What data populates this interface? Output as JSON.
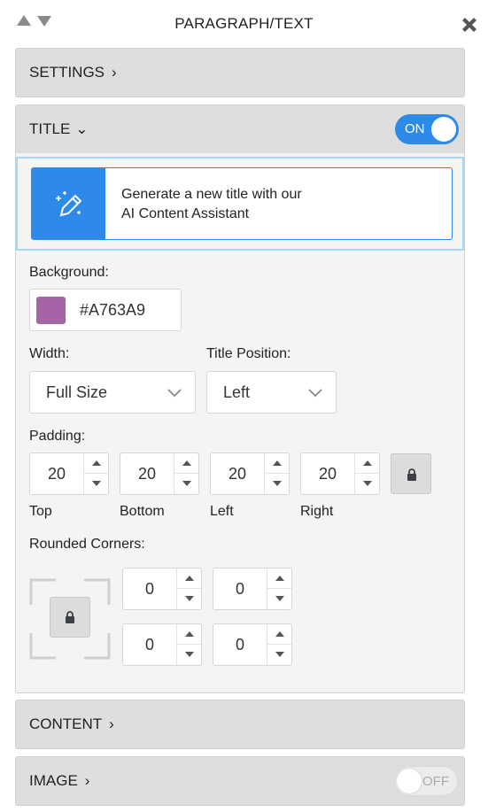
{
  "header": {
    "title": "PARAGRAPH/TEXT"
  },
  "sections": {
    "settings": {
      "label": "SETTINGS",
      "chevron": "›"
    },
    "title": {
      "label": "TITLE",
      "chevron": "⌄",
      "toggle": "ON"
    },
    "content": {
      "label": "CONTENT",
      "chevron": "›"
    },
    "image": {
      "label": "IMAGE",
      "chevron": "›",
      "toggle": "OFF"
    }
  },
  "ai_assistant": {
    "line1": "Generate a new title with our",
    "line2": "AI Content Assistant",
    "icon": "magic-pen-icon"
  },
  "background": {
    "label": "Background:",
    "hex": "#A763A9",
    "swatch_color": "#a763a9"
  },
  "width": {
    "label": "Width:",
    "value": "Full Size"
  },
  "title_position": {
    "label": "Title Position:",
    "value": "Left"
  },
  "padding": {
    "label": "Padding:",
    "top": {
      "value": "20",
      "label": "Top"
    },
    "bottom": {
      "value": "20",
      "label": "Bottom"
    },
    "left": {
      "value": "20",
      "label": "Left"
    },
    "right": {
      "value": "20",
      "label": "Right"
    }
  },
  "rounded_corners": {
    "label": "Rounded Corners:",
    "top_left": "0",
    "top_right": "0",
    "bottom_left": "0",
    "bottom_right": "0"
  },
  "colors": {
    "accent": "#2d8ae8",
    "bar_bg": "#dedede",
    "panel_bg": "#f4f4f4",
    "ai_border": "#a6d7f5"
  }
}
